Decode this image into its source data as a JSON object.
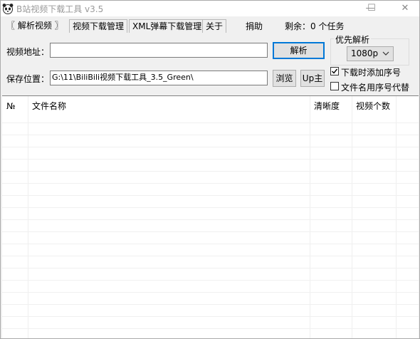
{
  "window": {
    "title": "B站视频下载工具 v3.5",
    "minimize": "—",
    "maximize": "☐",
    "close": "✕"
  },
  "tabs": [
    {
      "label": "〖 解析视频 〗"
    },
    {
      "label": "视频下载管理"
    },
    {
      "label": "XML弹幕下载管理"
    },
    {
      "label": "关于"
    }
  ],
  "toolbar": {
    "donate": "捐助",
    "remaining": "剩余：0 个任务"
  },
  "form": {
    "url_label": "视频地址：",
    "url_value": "",
    "parse_button": "解析",
    "save_label": "保存位置：",
    "save_path": "G:\\11\\BiliBili视频下载工具_3.5_Green\\",
    "browse_button": "浏览",
    "up_button": "Up主",
    "priority_group": "优先解析",
    "quality_selected": "1080p",
    "add_index_checkbox": {
      "label": "下载时添加序号",
      "checked": true
    },
    "replace_name_checkbox": {
      "label": "文件名用序号代替",
      "checked": false
    }
  },
  "table": {
    "columns": [
      "№",
      "文件名称",
      "清晰度",
      "视频个数"
    ],
    "rows": []
  },
  "colors": {
    "accent": "#0078d7",
    "window_bg": "#f0f0f0"
  },
  "icons": {
    "app": "panda-icon",
    "parse": "none"
  }
}
